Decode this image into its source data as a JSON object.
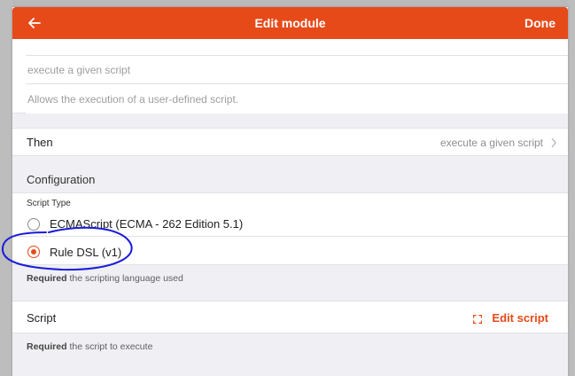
{
  "navbar": {
    "title": "Edit module",
    "done_label": "Done",
    "back_icon": "arrow-left-icon",
    "background": "#e64a19"
  },
  "module": {
    "label_value": "execute a given script",
    "description_value": "Allows the execution of a user-defined script."
  },
  "then": {
    "label": "Then",
    "value": "execute a given script",
    "icon": "chevron-right-icon"
  },
  "configuration": {
    "title": "Configuration",
    "script_type": {
      "label": "Script Type",
      "options": [
        {
          "label": "ECMAScript (ECMA - 262 Edition 5.1)",
          "selected": false
        },
        {
          "label": "Rule DSL (v1)",
          "selected": true
        }
      ],
      "required_label": "Required",
      "help": "the scripting language used"
    },
    "script": {
      "label": "Script",
      "edit_label": "Edit script",
      "expand_icon": "expand-icon",
      "required_label": "Required",
      "help": "the script to execute"
    }
  },
  "annotation": {
    "color": "#1a1adb"
  }
}
